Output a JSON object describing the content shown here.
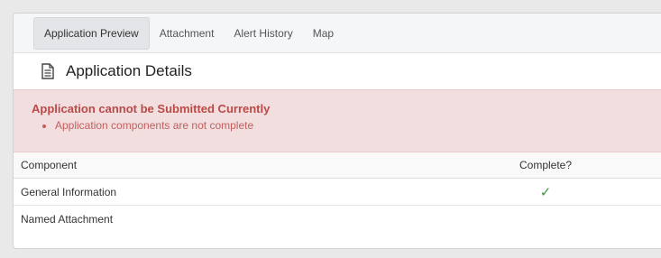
{
  "tabs": [
    {
      "label": "Application Preview",
      "active": true
    },
    {
      "label": "Attachment",
      "active": false
    },
    {
      "label": "Alert History",
      "active": false
    },
    {
      "label": "Map",
      "active": false
    }
  ],
  "details": {
    "title": "Application Details",
    "icon": "document-icon"
  },
  "alert": {
    "title": "Application cannot be Submitted Currently",
    "items": [
      "Application components are not complete"
    ],
    "background_color": "#f2dede",
    "text_color": "#b94a48"
  },
  "table": {
    "headers": {
      "component": "Component",
      "complete": "Complete?"
    },
    "rows": [
      {
        "component": "General Information",
        "complete": "✓"
      },
      {
        "component": "Named Attachment",
        "complete": ""
      }
    ]
  },
  "colors": {
    "check": "#3c9a3c"
  }
}
